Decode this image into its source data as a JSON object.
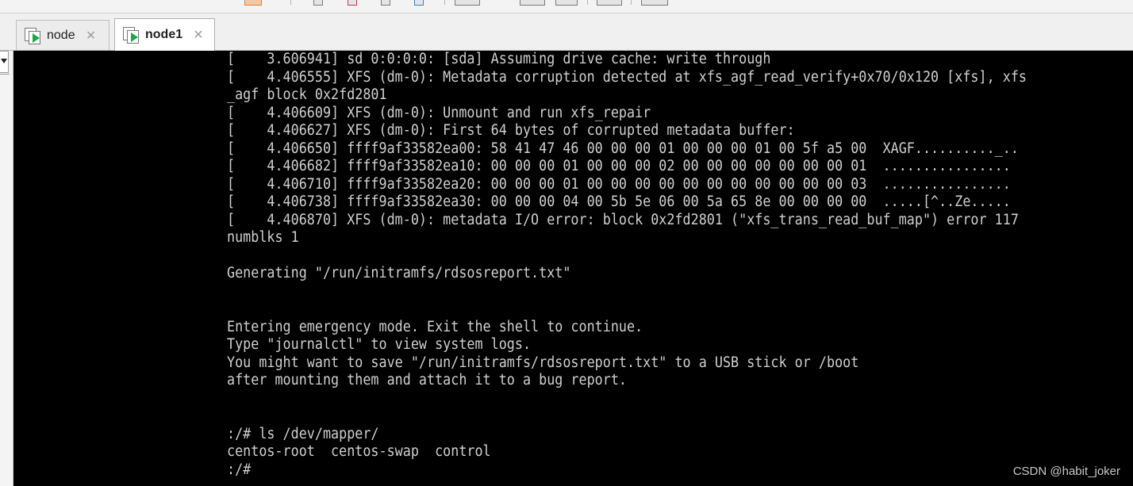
{
  "tabs": [
    {
      "label": "node",
      "active": false,
      "close_icon": "×"
    },
    {
      "label": "node1",
      "active": true,
      "close_icon": "×"
    }
  ],
  "console": {
    "lines": [
      "[    3.606941] sd 0:0:0:0: [sda] Assuming drive cache: write through",
      "[    4.406555] XFS (dm-0): Metadata corruption detected at xfs_agf_read_verify+0x70/0x120 [xfs], xfs",
      "_agf block 0x2fd2801",
      "[    4.406609] XFS (dm-0): Unmount and run xfs_repair",
      "[    4.406627] XFS (dm-0): First 64 bytes of corrupted metadata buffer:",
      "[    4.406650] ffff9af33582ea00: 58 41 47 46 00 00 00 01 00 00 00 01 00 5f a5 00  XAGF.........._..",
      "[    4.406682] ffff9af33582ea10: 00 00 00 01 00 00 00 02 00 00 00 00 00 00 00 01  ................",
      "[    4.406710] ffff9af33582ea20: 00 00 00 01 00 00 00 00 00 00 00 00 00 00 00 03  ................",
      "[    4.406738] ffff9af33582ea30: 00 00 00 04 00 5b 5e 06 00 5a 65 8e 00 00 00 00  .....[^..Ze.....",
      "[    4.406870] XFS (dm-0): metadata I/O error: block 0x2fd2801 (\"xfs_trans_read_buf_map\") error 117",
      "numblks 1",
      "",
      "Generating \"/run/initramfs/rdsosreport.txt\"",
      "",
      "",
      "Entering emergency mode. Exit the shell to continue.",
      "Type \"journalctl\" to view system logs.",
      "You might want to save \"/run/initramfs/rdsosreport.txt\" to a USB stick or /boot",
      "after mounting them and attach it to a bug report.",
      "",
      "",
      ":/# ls /dev/mapper/",
      "centos-root  centos-swap  control",
      ":/#"
    ]
  },
  "watermark": "CSDN @habit_joker",
  "colors": {
    "console_bg": "#000000",
    "console_text": "#cfcfcf",
    "play_icon": "#19a84a"
  }
}
